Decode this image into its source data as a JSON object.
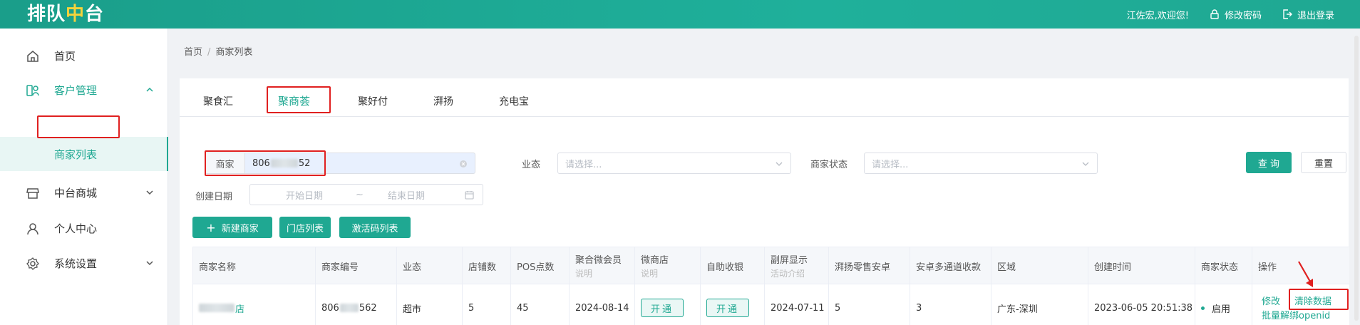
{
  "header": {
    "logo_part1": "排队",
    "logo_part2": "中",
    "logo_part3": "台",
    "welcome": "江佐宏,欢迎您!",
    "change_password": "修改密码",
    "logout": "退出登录"
  },
  "sidebar": {
    "items": [
      {
        "label": "首页",
        "icon": "home-icon"
      },
      {
        "label": "客户管理",
        "icon": "customer-icon"
      },
      {
        "label": "商家列表"
      },
      {
        "label": "中台商城",
        "icon": "store-icon"
      },
      {
        "label": "个人中心",
        "icon": "user-icon"
      },
      {
        "label": "系统设置",
        "icon": "gear-icon"
      }
    ]
  },
  "breadcrumb": {
    "home": "首页",
    "sep": "/",
    "current": "商家列表"
  },
  "tabs": [
    "聚食汇",
    "聚商荟",
    "聚好付",
    "湃扬",
    "充电宝"
  ],
  "filters": {
    "merchant_label": "商家",
    "merchant_value_prefix": "806",
    "merchant_value_suffix": "52",
    "industry_label": "业态",
    "industry_placeholder": "请选择...",
    "status_label": "商家状态",
    "status_placeholder": "请选择...",
    "created_label": "创建日期",
    "start_placeholder": "开始日期",
    "range_sep": "~",
    "end_placeholder": "结束日期",
    "query_btn": "查 询",
    "reset_btn": "重置"
  },
  "actions": {
    "new_merchant": "新建商家",
    "store_list": "门店列表",
    "activation_list": "激活码列表"
  },
  "table": {
    "columns": [
      {
        "label": "商家名称"
      },
      {
        "label": "商家编号"
      },
      {
        "label": "业态"
      },
      {
        "label": "店铺数"
      },
      {
        "label": "POS点数"
      },
      {
        "label": "聚合微会员",
        "sub": "说明"
      },
      {
        "label": "微商店",
        "sub": "说明"
      },
      {
        "label": "自助收银"
      },
      {
        "label": "副屏显示",
        "sub": "活动介绍"
      },
      {
        "label": "湃扬零售安卓"
      },
      {
        "label": "安卓多通道收款"
      },
      {
        "label": "区域"
      },
      {
        "label": "创建时间"
      },
      {
        "label": "商家状态"
      },
      {
        "label": "操作"
      }
    ],
    "row": {
      "name_suffix": "店",
      "code_prefix": "806",
      "code_suffix": "562",
      "industry": "超市",
      "stores": "5",
      "pos": "45",
      "member_date": "2024-08-14",
      "open1": "开通",
      "open2": "开通",
      "screen_date": "2024-07-11",
      "pyretail": "5",
      "multichannel": "3",
      "region": "广东-深圳",
      "created": "2023-06-05 20:51:38",
      "status": "启用",
      "op_edit": "修改",
      "op_clear": "清除数据",
      "op_unbind": "批量解绑openid"
    }
  },
  "colors": {
    "accent": "#1fa892",
    "highlight": "#e02020",
    "logo_yellow": "#f6d33b"
  }
}
